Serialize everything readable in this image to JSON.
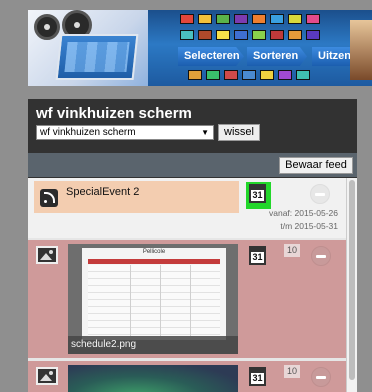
{
  "banner": {
    "nav": [
      "Selecteren",
      "Sorteren",
      "Uitzenden"
    ]
  },
  "panel": {
    "title": "wf vinkhuizen scherm",
    "select_value": "wf vinkhuizen scherm",
    "wissel_label": "wissel",
    "save_label": "Bewaar feed"
  },
  "items": [
    {
      "type": "rss",
      "title": "SpecialEvent 2",
      "calendar_day": "31",
      "from_label": "vanaf: 2015-05-26",
      "to_label": "t/m 2015-05-31"
    },
    {
      "type": "image",
      "preview_title": "Pellicole",
      "filename": "schedule2.png",
      "calendar_day": "31",
      "duration": "10"
    },
    {
      "type": "image",
      "calendar_day": "31",
      "duration": "10"
    }
  ],
  "colors": {
    "page_bg": "#8f8f8f",
    "panel_bg": "#323232",
    "toolbar_bg": "#5a646d",
    "rss_item_bg": "#f3cdb0",
    "image_item_bg": "#cf9a9a",
    "calendar_active": "#22d72a"
  }
}
